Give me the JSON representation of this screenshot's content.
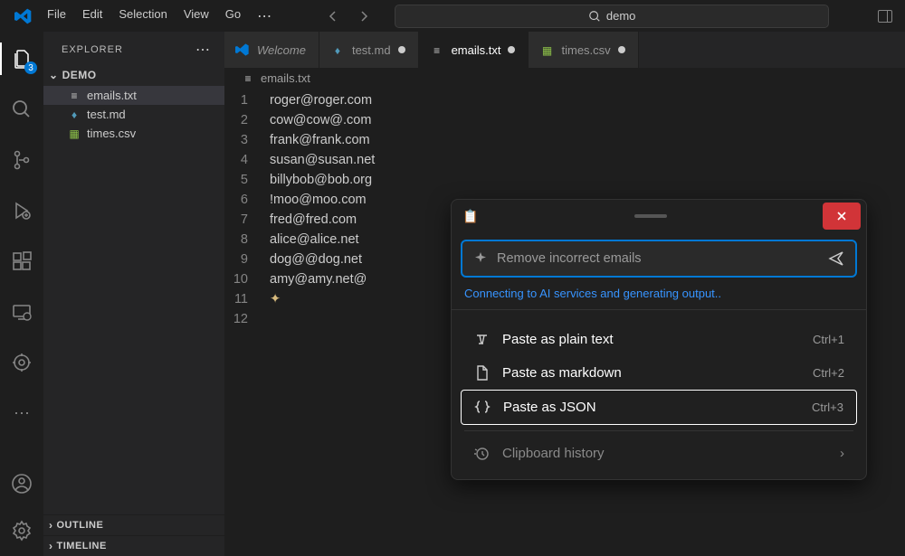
{
  "menu": {
    "file": "File",
    "edit": "Edit",
    "selection": "Selection",
    "view": "View",
    "go": "Go"
  },
  "search": {
    "placeholder": "demo"
  },
  "activity": {
    "badge": "3"
  },
  "sidebar": {
    "title": "EXPLORER",
    "folder": "DEMO",
    "files": [
      {
        "name": "emails.txt",
        "iconClass": "txt",
        "glyph": "≡",
        "active": true
      },
      {
        "name": "test.md",
        "iconClass": "md",
        "glyph": "♦",
        "active": false
      },
      {
        "name": "times.csv",
        "iconClass": "csv",
        "glyph": "▦",
        "active": false
      }
    ],
    "outline": "OUTLINE",
    "timeline": "TIMELINE"
  },
  "tabs": [
    {
      "label": "Welcome",
      "iconClass": "vscode",
      "italic": true,
      "active": false,
      "dirty": false
    },
    {
      "label": "test.md",
      "iconClass": "md",
      "italic": false,
      "active": false,
      "dirty": true
    },
    {
      "label": "emails.txt",
      "iconClass": "txt",
      "italic": false,
      "active": true,
      "dirty": true
    },
    {
      "label": "times.csv",
      "iconClass": "csv",
      "italic": false,
      "active": false,
      "dirty": true
    }
  ],
  "breadcrumb": {
    "icon": "≡",
    "text": "emails.txt"
  },
  "editor": {
    "lines": [
      "roger@roger.com",
      "cow@cow@.com",
      "frank@frank.com",
      "susan@susan.net",
      "billybob@bob.org",
      "!moo@moo.com",
      "fred@fred.com",
      "alice@alice.net",
      "dog@@dog.net",
      "amy@amy.net@",
      "✦",
      ""
    ]
  },
  "popup": {
    "prompt": "Remove incorrect emails",
    "status": "Connecting to AI services and generating output..",
    "options": [
      {
        "label": "Paste as plain text",
        "shortcut": "Ctrl+1",
        "icon": "text"
      },
      {
        "label": "Paste as markdown",
        "shortcut": "Ctrl+2",
        "icon": "doc"
      },
      {
        "label": "Paste as JSON",
        "shortcut": "Ctrl+3",
        "icon": "json",
        "selected": true
      }
    ],
    "history": "Clipboard history"
  }
}
